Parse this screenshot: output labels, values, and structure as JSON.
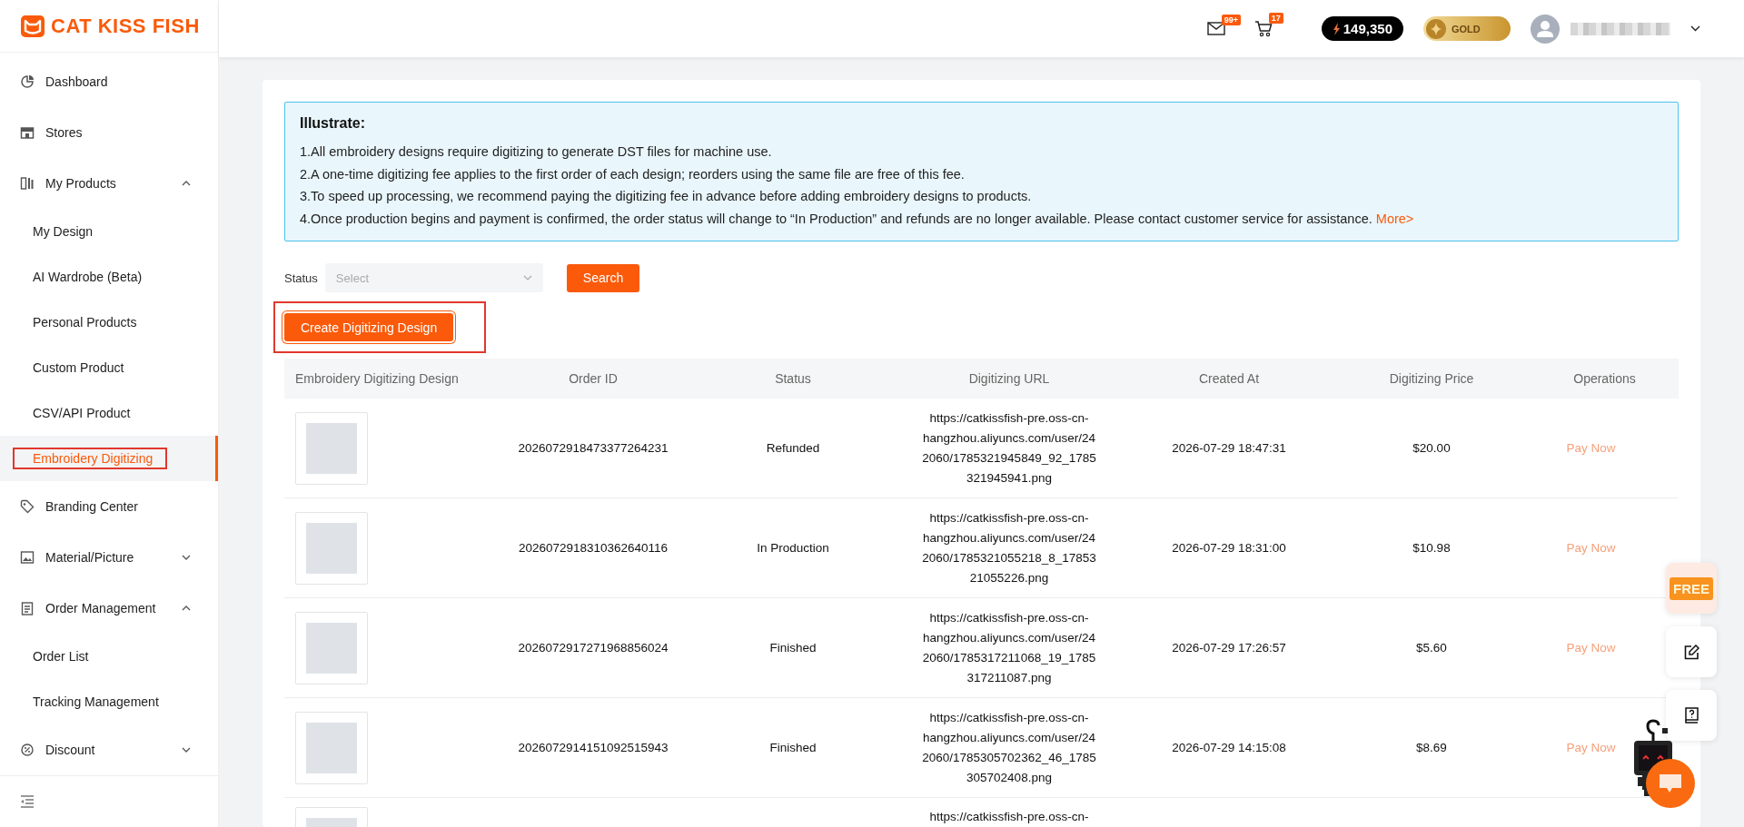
{
  "logo": {
    "text": "CAT KISS FISH"
  },
  "header": {
    "mail_badge": "99+",
    "cart_badge": "17",
    "points": "149,350",
    "level": "GOLD"
  },
  "sidebar": {
    "items": [
      {
        "label": "Dashboard",
        "kind": "link",
        "selected": false
      },
      {
        "label": "Stores",
        "kind": "link",
        "selected": false
      },
      {
        "label": "My Products",
        "kind": "group",
        "expanded": true,
        "selected": false,
        "children": [
          {
            "label": "My Design",
            "selected": false
          },
          {
            "label": "AI Wardrobe (Beta)",
            "selected": false
          },
          {
            "label": "Personal Products",
            "selected": false
          },
          {
            "label": "Custom Product",
            "selected": false
          },
          {
            "label": "CSV/API Product",
            "selected": false
          },
          {
            "label": "Embroidery Digitizing",
            "selected": true
          }
        ]
      },
      {
        "label": "Branding Center",
        "kind": "link",
        "selected": false
      },
      {
        "label": "Material/Picture",
        "kind": "group",
        "expanded": false,
        "selected": false
      },
      {
        "label": "Order Management",
        "kind": "group",
        "expanded": true,
        "selected": false,
        "children": [
          {
            "label": "Order List",
            "selected": false
          },
          {
            "label": "Tracking Management",
            "selected": false
          }
        ]
      },
      {
        "label": "Discount",
        "kind": "group",
        "expanded": false,
        "selected": false
      }
    ]
  },
  "notice": {
    "title": "Illustrate:",
    "lines": [
      "1.All embroidery designs require digitizing to generate DST files for machine use.",
      "2.A one-time digitizing fee applies to the first order of each design; reorders using the same file are free of this fee.",
      "3.To speed up processing, we recommend paying the digitizing fee in advance before adding embroidery designs to products.",
      "4.Once production begins and payment is confirmed, the order status will change to “In Production” and refunds are no longer available. Please contact customer service for assistance."
    ],
    "more_link": "More>"
  },
  "filter": {
    "label": "Status",
    "placeholder": "Select",
    "search_button": "Search"
  },
  "create_button": "Create Digitizing Design",
  "table": {
    "columns": [
      "Embroidery Digitizing Design",
      "Order ID",
      "Status",
      "Digitizing URL",
      "Created At",
      "Digitizing Price",
      "Operations"
    ],
    "rows": [
      {
        "order_id": "2026072918473377264231",
        "status": "Refunded",
        "url": "https://catkissfish-pre.oss-cn-hangzhou.aliyuncs.com/user/242060/1785321945849_92_1785321945941.png",
        "created_at": "2026-07-29 18:47:31",
        "price": "$20.00",
        "operation": "Pay Now"
      },
      {
        "order_id": "2026072918310362640116",
        "status": "In Production",
        "url": "https://catkissfish-pre.oss-cn-hangzhou.aliyuncs.com/user/242060/1785321055218_8_1785321055226.png",
        "created_at": "2026-07-29 18:31:00",
        "price": "$10.98",
        "operation": "Pay Now"
      },
      {
        "order_id": "2026072917271968856024",
        "status": "Finished",
        "url": "https://catkissfish-pre.oss-cn-hangzhou.aliyuncs.com/user/242060/1785317211068_19_1785317211087.png",
        "created_at": "2026-07-29 17:26:57",
        "price": "$5.60",
        "operation": "Pay Now"
      },
      {
        "order_id": "2026072914151092515943",
        "status": "Finished",
        "url": "https://catkissfish-pre.oss-cn-hangzhou.aliyuncs.com/user/242060/1785305702362_46_1785305702408.png",
        "created_at": "2026-07-29 14:15:08",
        "price": "$8.69",
        "operation": "Pay Now"
      },
      {
        "url": "https://catkissfish-pre.oss-cn-"
      }
    ]
  },
  "promo": {
    "text": "FREE"
  }
}
